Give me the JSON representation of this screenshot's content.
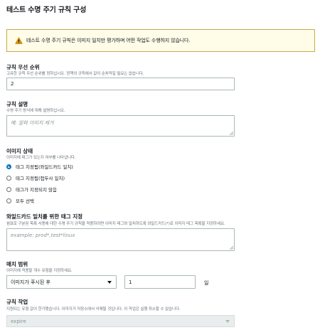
{
  "page": {
    "title": "테스트 수명 주기 규칙 구성"
  },
  "alert": {
    "text": "테스트 수명 주기 규칙은 이미지 일치만 평가하며 어떤 작업도 수행하지 않습니다.",
    "color": "#c8a94a"
  },
  "rule_priority": {
    "label": "규칙 우선 순위",
    "description": "고유한 규칙 우선 순위를 정하십시오. 정책의 규칙에서 값이 순차적일 필요는 없습니다.",
    "value": "2"
  },
  "rule_description": {
    "label": "규칙 설명",
    "description": "수명 주기 방식에 대해 설명하십시오.",
    "placeholder": "예: 알파 이미지 제거"
  },
  "image_status": {
    "label": "이미지 상태",
    "description": "이미지에 태그가 있는지 여부를 나타냅니다.",
    "options": [
      {
        "label": "태그 지정됨(와일드카드 일치)",
        "selected": true
      },
      {
        "label": "태그 지정됨(접두사 일치)",
        "selected": false
      },
      {
        "label": "태그가 지정되지 않음",
        "selected": false
      },
      {
        "label": "모두 선택",
        "selected": false
      }
    ]
  },
  "wildcard_tags": {
    "label": "와일드카드 일치를 위한 태그 지정",
    "description": "쉼표로 구분된 목록 사용에 대한 수명 주기 규칙을 적용하려면 이미지 태그와 일치하도록 와일드카드(*)로 이미지 태그 목록을 지정하세요.",
    "placeholder": "example: prod*,test*linux"
  },
  "match_scope": {
    "label": "매치 범위",
    "description": "이미지에 적용할 개수 유형을 지정하세요.",
    "select_value": "이미지가 푸시된 후",
    "count_value": "1",
    "unit": "일"
  },
  "rule_action": {
    "label": "규칙 작업",
    "description": "지원되는 유형 값이 한가했습니다. 이미지가 저장소에서 삭제될 것입니다. 이 작업은 실행 취소할 수 없습니다.",
    "value": "expire"
  },
  "colors": {
    "accent": "#0073bb",
    "border": "#aab7b8",
    "warning_bg": "#fffce8"
  }
}
